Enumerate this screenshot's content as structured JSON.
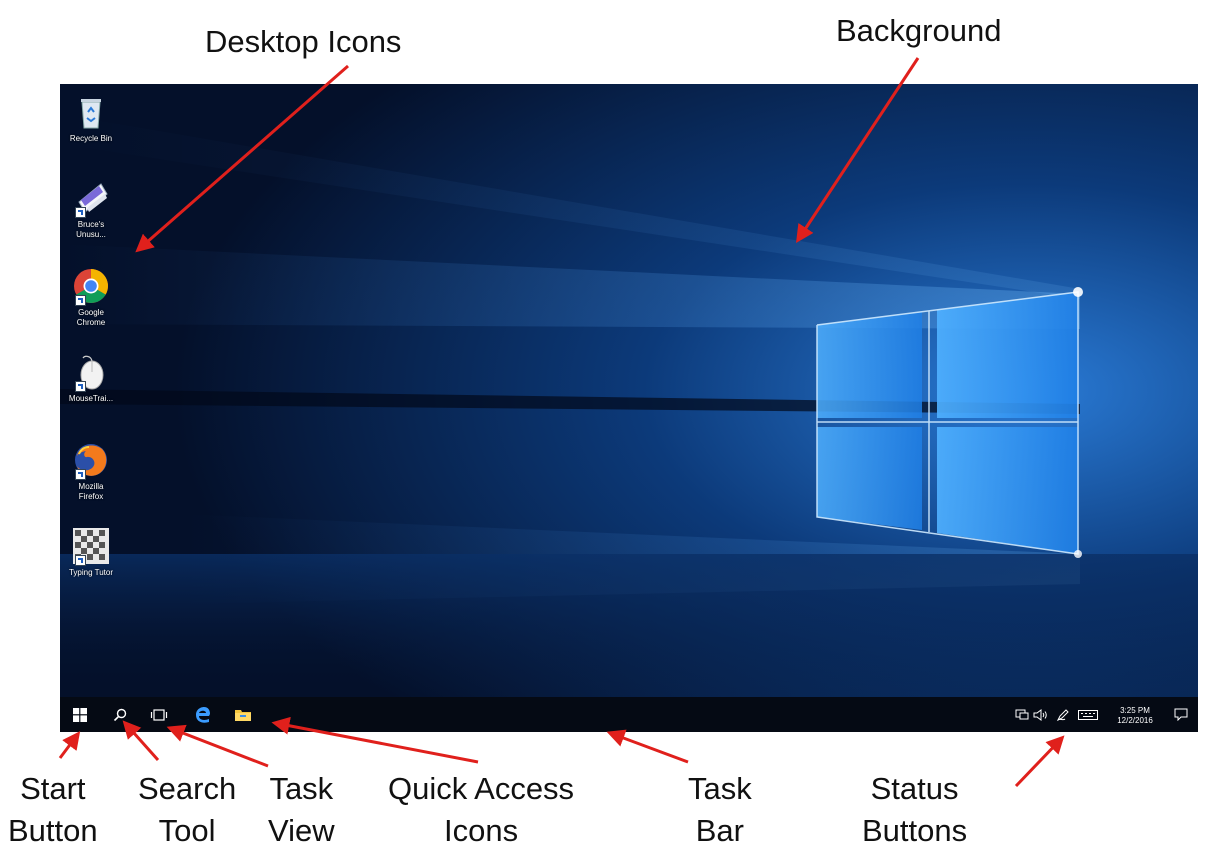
{
  "callouts": {
    "desktop_icons": "Desktop Icons",
    "background": "Background",
    "start_button": [
      "Start",
      "Button"
    ],
    "search_tool": [
      "Search",
      "Tool"
    ],
    "task_view": [
      "Task",
      "View"
    ],
    "quick_access": [
      "Quick Access",
      "Icons"
    ],
    "task_bar": [
      "Task",
      "Bar"
    ],
    "status_buttons": [
      "Status",
      "Buttons"
    ]
  },
  "desktop": {
    "icons": [
      {
        "label": "Recycle Bin",
        "icon": "recycle-bin-icon"
      },
      {
        "label": "Bruce's\nUnusu...",
        "icon": "document-shortcut-icon"
      },
      {
        "label": "Google\nChrome",
        "icon": "chrome-icon"
      },
      {
        "label": "MouseTrai...",
        "icon": "mouse-icon"
      },
      {
        "label": "Mozilla\nFirefox",
        "icon": "firefox-icon"
      },
      {
        "label": "Typing Tutor",
        "icon": "typing-tutor-icon"
      }
    ]
  },
  "taskbar": {
    "buttons": [
      "start-icon",
      "search-icon",
      "task-view-icon",
      "edge-icon",
      "file-explorer-icon"
    ],
    "tray_icons": [
      "network-icon",
      "volume-icon",
      "pen-icon",
      "keyboard-icon"
    ],
    "time": "3:25 PM",
    "date": "12/2/2016",
    "notifications_icon": "action-center-icon"
  },
  "colors": {
    "arrow": "#e0201c",
    "taskbar": "#050a14",
    "wallpaper_dark": "#06142e",
    "wallpaper_light": "#3aa0ff"
  }
}
